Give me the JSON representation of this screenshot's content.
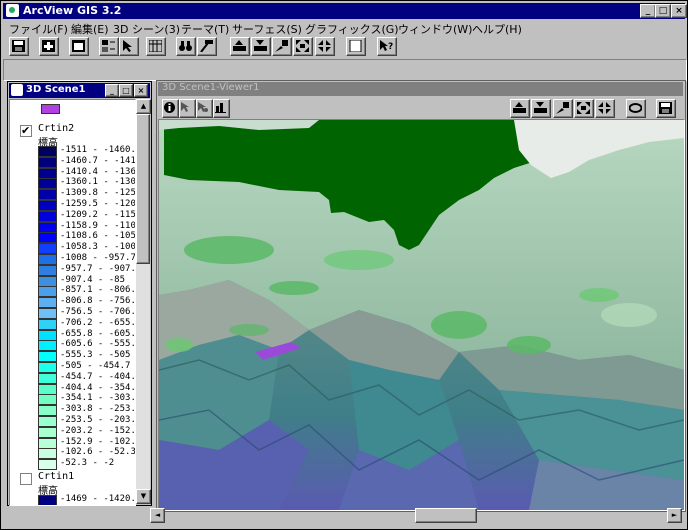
{
  "app": {
    "title": "ArcView GIS 3.2"
  },
  "window_buttons": {
    "minimize": "_",
    "maximize": "□",
    "close": "×"
  },
  "menu": [
    {
      "label": "ファイル(F)"
    },
    {
      "label": "編集(E)"
    },
    {
      "label": "3D シーン(3)"
    },
    {
      "label": "テーマ(T)"
    },
    {
      "label": "サーフェス(S)"
    },
    {
      "label": "グラフィックス(G)"
    },
    {
      "label": "ウィンドウ(W)"
    },
    {
      "label": "ヘルプ(H)"
    }
  ],
  "legend_window": {
    "title": "3D Scene1",
    "theme1_name": "Crtin2",
    "theme1_field": "標高",
    "theme1_checked": "✔",
    "theme1_classes": [
      {
        "label": "-1511 - -1460.",
        "color": "#000060"
      },
      {
        "label": "-1460.7 - -141",
        "color": "#00007c"
      },
      {
        "label": "-1410.4 - -136",
        "color": "#00008c"
      },
      {
        "label": "-1360.1 - -130",
        "color": "#000099"
      },
      {
        "label": "-1309.8 - -125",
        "color": "#0000aa"
      },
      {
        "label": "-1259.5 - -120",
        "color": "#0000c0"
      },
      {
        "label": "-1209.2 - -115",
        "color": "#0000d8"
      },
      {
        "label": "-1158.9 - -110",
        "color": "#0000ee"
      },
      {
        "label": "-1108.6 - -105",
        "color": "#0000ff"
      },
      {
        "label": "-1058.3 - -100",
        "color": "#1040ff"
      },
      {
        "label": "-1008 - -957.7",
        "color": "#1f6fe8"
      },
      {
        "label": "-957.7 - -907.",
        "color": "#2f7fe0"
      },
      {
        "label": "-907.4 - -85",
        "color": "#3f8fe0"
      },
      {
        "label": "-857.1 - -806.",
        "color": "#4f9fe8"
      },
      {
        "label": "-806.8 - -756.",
        "color": "#5fb0f0"
      },
      {
        "label": "-756.5 - -706.",
        "color": "#70c0f8"
      },
      {
        "label": "-706.2 - -655.",
        "color": "#30d0f8"
      },
      {
        "label": "-655.8 - -605.",
        "color": "#00e0ff"
      },
      {
        "label": "-605.6 - -555.",
        "color": "#00f0ff"
      },
      {
        "label": "-555.3 - -505",
        "color": "#00ffff"
      },
      {
        "label": "-505 - -454.7",
        "color": "#20ffe8"
      },
      {
        "label": "-454.7 - -404.",
        "color": "#40ffd8"
      },
      {
        "label": "-404.4 - -354.",
        "color": "#58ffc8"
      },
      {
        "label": "-354.1 - -303.",
        "color": "#70ffc0"
      },
      {
        "label": "-303.8 - -253.",
        "color": "#88ffc8"
      },
      {
        "label": "-253.5 - -203.",
        "color": "#98ffd0"
      },
      {
        "label": "-203.2 - -152.",
        "color": "#a8ffd0"
      },
      {
        "label": "-152.9 - -102.",
        "color": "#b8ffd8"
      },
      {
        "label": "-102.6 - -52.3",
        "color": "#c8ffe0"
      },
      {
        "label": "-52.3 - -2",
        "color": "#d8ffe8"
      }
    ],
    "theme2_name": "Crtin1",
    "theme2_field": "標高",
    "theme2_first": {
      "label": "-1469 - -1420.",
      "color": "#00007c"
    }
  },
  "viewer": {
    "title": "3D Scene1-Viewer1"
  }
}
